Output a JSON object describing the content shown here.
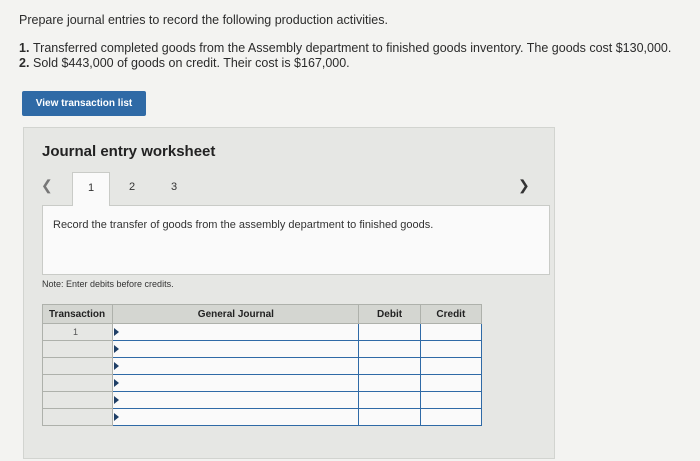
{
  "intro": "Prepare journal entries to record the following production activities.",
  "items": [
    {
      "num": "1.",
      "text": "Transferred completed goods from the Assembly department to finished goods inventory. The goods cost $130,000."
    },
    {
      "num": "2.",
      "text": "Sold $443,000 of goods on credit. Their cost is $167,000."
    }
  ],
  "button_label": "View transaction list",
  "worksheet": {
    "title": "Journal entry worksheet",
    "tabs": [
      "1",
      "2",
      "3"
    ],
    "prev_icon": "chevron-left-icon",
    "next_icon": "chevron-right-icon",
    "instruction": "Record the transfer of goods from the assembly department to finished goods.",
    "note": "Note: Enter debits before credits.",
    "table": {
      "headers": [
        "Transaction",
        "General Journal",
        "Debit",
        "Credit"
      ],
      "transaction_number": "1"
    }
  }
}
